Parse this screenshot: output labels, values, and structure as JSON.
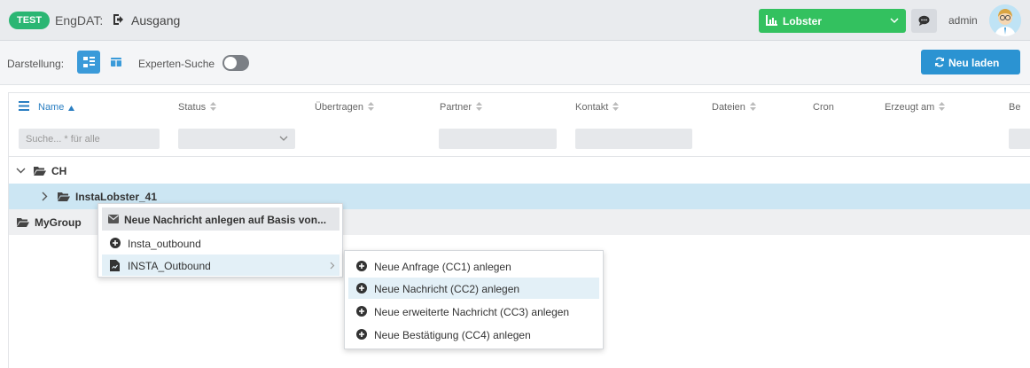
{
  "header": {
    "badge": "TEST",
    "app_name": "EngDAT:",
    "section": "Ausgang",
    "selector_value": "Lobster",
    "user": "admin"
  },
  "toolbar": {
    "view_label": "Darstellung:",
    "expert_search_label": "Experten-Suche",
    "expert_search_on": false,
    "reload_label": "Neu laden"
  },
  "table": {
    "columns": [
      "Name",
      "Status",
      "Übertragen",
      "Partner",
      "Kontakt",
      "Dateien",
      "Cron",
      "Erzeugt am",
      "Be"
    ],
    "search_placeholder": "Suche... * für alle"
  },
  "tree": {
    "nodes": [
      "CH",
      "InstaLobster_41",
      "MyGroup"
    ]
  },
  "context_menu": {
    "title": "Neue Nachricht anlegen auf Basis von...",
    "items": [
      "Insta_outbound",
      "INSTA_Outbound"
    ]
  },
  "submenu": {
    "items": [
      "Neue Anfrage (CC1) anlegen",
      "Neue Nachricht (CC2) anlegen",
      "Neue erweiterte Nachricht (CC3) anlegen",
      "Neue Bestätigung (CC4) anlegen"
    ]
  },
  "colors": {
    "badge": "#2bb673",
    "selector": "#33c15f",
    "primary": "#2b93d2",
    "selected_row": "#cce6f3"
  }
}
